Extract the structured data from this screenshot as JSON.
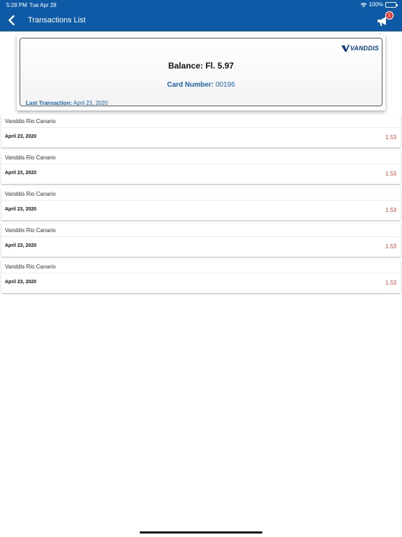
{
  "status_bar": {
    "time": "5:28 PM",
    "date": "Tue Apr 28",
    "battery": "100%"
  },
  "nav": {
    "title": "Transactions List",
    "notification_count": "1"
  },
  "card": {
    "logo_text": "VANDDIS",
    "balance": "Balance: Fl. 5.97",
    "card_number_label": "Card Number:",
    "card_number": "00196",
    "last_tx_label": "Last Transaction:",
    "last_tx_date": "April 23, 2020"
  },
  "transactions": [
    {
      "merchant": "Vanddis Rio Canario",
      "date": "April 23, 2020",
      "amount": "1.53"
    },
    {
      "merchant": "Vanddis Rio Canario",
      "date": "April 23, 2020",
      "amount": "1.53"
    },
    {
      "merchant": "Vanddis Rio Canario",
      "date": "April 23, 2020",
      "amount": "1.53"
    },
    {
      "merchant": "Vanddis Rio Canario",
      "date": "April 23, 2020",
      "amount": "1.53"
    },
    {
      "merchant": "Vanddis Rio Canario",
      "date": "April 23, 2020",
      "amount": "1.53"
    }
  ],
  "colors": {
    "brand": "#0e5aa7",
    "amount": "#e53935",
    "link": "#1a5fa8"
  }
}
